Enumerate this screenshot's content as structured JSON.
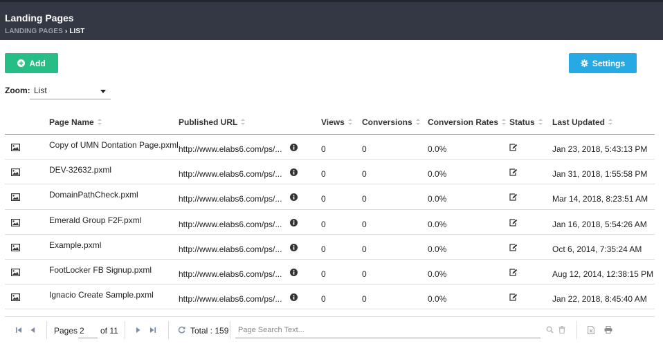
{
  "header": {
    "title": "Landing Pages",
    "breadcrumb_root": "LANDING PAGES",
    "breadcrumb_sep": "›",
    "breadcrumb_current": "LIST"
  },
  "toolbar": {
    "add_label": "Add",
    "settings_label": "Settings"
  },
  "zoom": {
    "label": "Zoom:",
    "value": "List"
  },
  "table": {
    "columns": {
      "page_name": "Page Name",
      "published_url": "Published URL",
      "views": "Views",
      "conversions": "Conversions",
      "conversion_rates": "Conversion Rates",
      "status": "Status",
      "last_updated": "Last Updated"
    },
    "rows": [
      {
        "name": "Copy of UMN Dontation Page.pxml",
        "url": "http://www.elabs6.com/ps/...",
        "views": "0",
        "conversions": "0",
        "rate": "0.0%",
        "updated": "Jan 23, 2018, 5:43:13 PM"
      },
      {
        "name": "DEV-32632.pxml",
        "url": "http://www.elabs6.com/ps/...",
        "views": "0",
        "conversions": "0",
        "rate": "0.0%",
        "updated": "Jan 31, 2018, 1:55:58 PM"
      },
      {
        "name": "DomainPathCheck.pxml",
        "url": "http://www.elabs6.com/ps/...",
        "views": "0",
        "conversions": "0",
        "rate": "0.0%",
        "updated": "Mar 14, 2018, 8:23:51 AM"
      },
      {
        "name": "Emerald Group F2F.pxml",
        "url": "http://www.elabs6.com/ps/...",
        "views": "0",
        "conversions": "0",
        "rate": "0.0%",
        "updated": "Jan 16, 2018, 5:54:26 AM"
      },
      {
        "name": "Example.pxml",
        "url": "http://www.elabs6.com/ps/...",
        "views": "0",
        "conversions": "0",
        "rate": "0.0%",
        "updated": "Oct 6, 2014, 7:35:24 AM"
      },
      {
        "name": "FootLocker FB Signup.pxml",
        "url": "http://www.elabs6.com/ps/...",
        "views": "0",
        "conversions": "0",
        "rate": "0.0%",
        "updated": "Aug 12, 2014, 12:38:15 PM"
      },
      {
        "name": "Ignacio Create Sample.pxml",
        "url": "http://www.elabs6.com/ps/...",
        "views": "0",
        "conversions": "0",
        "rate": "0.0%",
        "updated": "Jan 22, 2018, 8:45:40 AM"
      }
    ]
  },
  "pager": {
    "pages_label": "Pages",
    "current_page": "2",
    "of_label": "of 11",
    "total_label": "Total : 159",
    "search_placeholder": "Page Search Text..."
  },
  "colors": {
    "header_bg": "#333844",
    "add_button": "#26bd86",
    "settings_button": "#27a9e3"
  },
  "icons": {
    "add": "plus-circle-icon",
    "settings": "gear-icon",
    "row_thumbnail": "image-icon",
    "url_info": "info-circle-icon",
    "status": "edit-icon",
    "first": "first-page-icon",
    "prev": "prev-page-icon",
    "next": "next-page-icon",
    "last": "last-page-icon",
    "refresh": "refresh-icon",
    "search": "search-icon",
    "clear": "trash-icon",
    "export": "excel-export-icon",
    "print": "print-icon"
  }
}
